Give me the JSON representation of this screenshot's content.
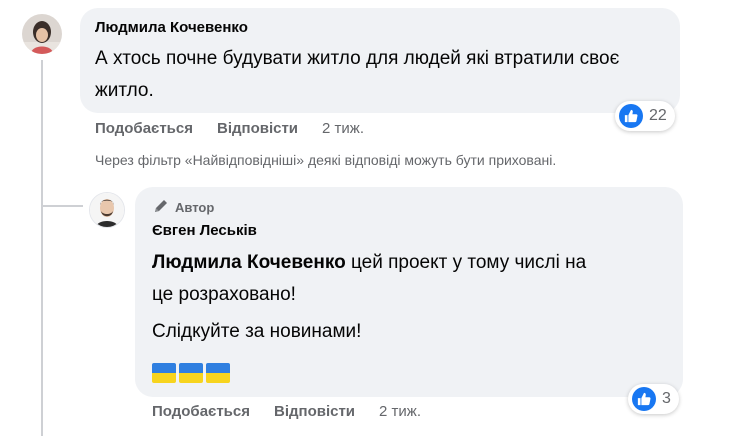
{
  "comment": {
    "author": "Людмила Кочевенко",
    "text": "А хтось почне будувати житло для людей які втратили своє житло.",
    "like_label": "Подобається",
    "reply_label": "Відповісти",
    "time": "2 тиж.",
    "reactions": "22"
  },
  "filter_note": "Через фільтр «Найвідповідніші» деякі відповіді можуть бути приховані.",
  "reply": {
    "badge": "Автор",
    "author": "Євген Леськів",
    "mention": "Людмила Кочевенко",
    "text_line1": " цей проект у тому числі на",
    "text_line2": "це розраховано!",
    "text_line3": "Слідкуйте за новинами!",
    "flags": [
      "ua-flag",
      "ua-flag",
      "ua-flag"
    ],
    "like_label": "Подобається",
    "reply_label": "Відповісти",
    "time": "2 тиж.",
    "reactions": "3"
  },
  "colors": {
    "bubble": "#f0f2f5",
    "like_blue": "#1877f2",
    "muted": "#65676b",
    "flag_blue": "#2f7fe0",
    "flag_yellow": "#f7d41e"
  }
}
